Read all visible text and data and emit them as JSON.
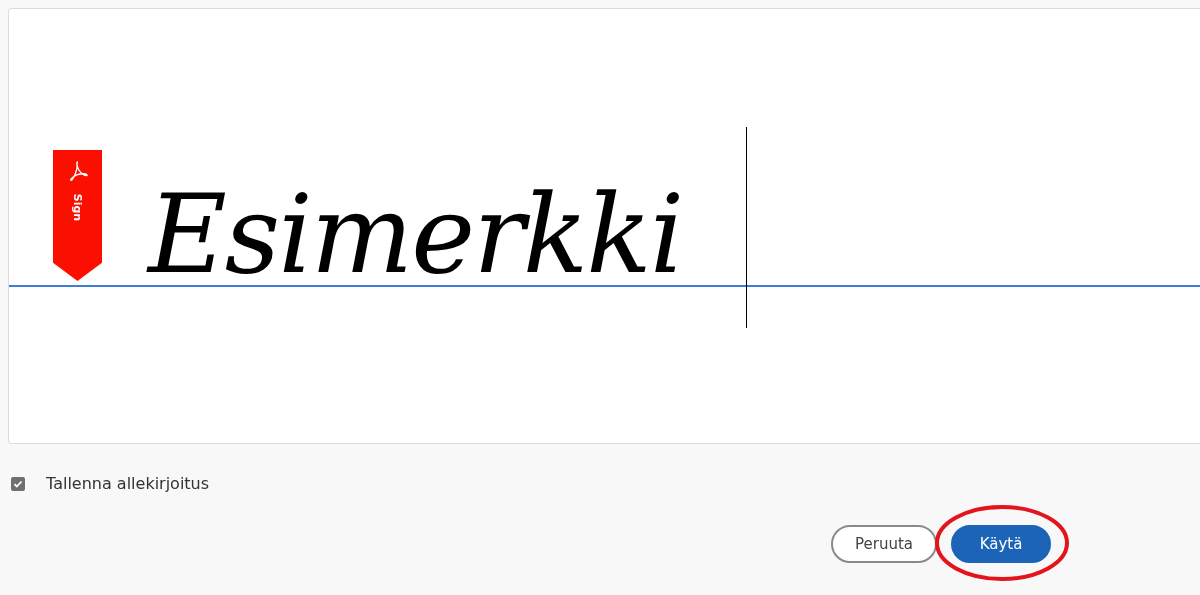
{
  "signature_panel": {
    "badge": "Sign",
    "signature": "Esimerkki"
  },
  "save_signature": {
    "label": "Tallenna allekirjoitus",
    "checked": true
  },
  "buttons": [
    {
      "label": "Peruuta",
      "kind": "secondary",
      "highlighted": false
    },
    {
      "label": "Käytä",
      "kind": "primary",
      "highlighted": true
    }
  ]
}
